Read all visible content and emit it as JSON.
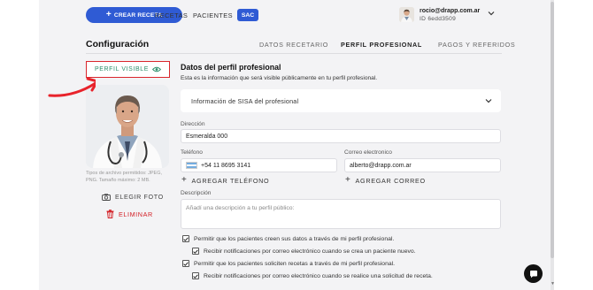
{
  "header": {
    "new_prescription_label": "CREAR RECETA",
    "nav": [
      "RECETAS",
      "PACIENTES"
    ],
    "sac_label": "SAC",
    "user": {
      "email": "rocio@drapp.com.ar",
      "id": "ID 6edd3509"
    }
  },
  "page": {
    "title": "Configuración",
    "tabs": [
      "DATOS RECETARIO",
      "PERFIL PROFESIONAL",
      "PAGOS Y REFERIDOS"
    ],
    "active_tab": "PERFIL PROFESIONAL"
  },
  "profile_sidebar": {
    "visible_label": "PERFIL VISIBLE",
    "photo_hint": "Tipos de archivo permitidos: JPEG, PNG. Tamaño máximo: 2 MB.",
    "choose_photo_label": "ELEGIR FOTO",
    "delete_label": "ELIMINAR"
  },
  "form": {
    "title": "Datos del perfil profesional",
    "subtitle": "Esta es la información que será visible públicamente en tu perfil profesional.",
    "sisa_label": "Información de SISA del profesional",
    "address": {
      "label": "Dirección",
      "value": "Esmeralda 000"
    },
    "phone": {
      "label": "Teléfono",
      "value": "+54 11 8695 3141"
    },
    "email": {
      "label": "Correo electronico",
      "value": "alberto@drapp.com.ar"
    },
    "add_phone_label": "AGREGAR TELÉFONO",
    "add_email_label": "AGREGAR CORREO",
    "description": {
      "label": "Descripción",
      "placeholder": "Añadí una descripción a tu perfil público:"
    },
    "checkboxes": [
      {
        "label": "Permitir que los pacientes creen sus datos a través de mi perfil profesional.",
        "checked": true
      },
      {
        "label": "Recibir notificaciones por correo electrónico cuando se crea un paciente nuevo.",
        "checked": true
      },
      {
        "label": "Permitir que los pacientes soliciten recetas a través de mi perfil profesional.",
        "checked": true
      },
      {
        "label": "Recibir notificaciones por correo electrónico cuando se realice una solicitud de receta.",
        "checked": true
      }
    ]
  },
  "colors": {
    "primary": "#2f5bd4",
    "visible_green": "#2a8e6a",
    "danger": "#d32027",
    "highlight_red": "#d9262c"
  }
}
